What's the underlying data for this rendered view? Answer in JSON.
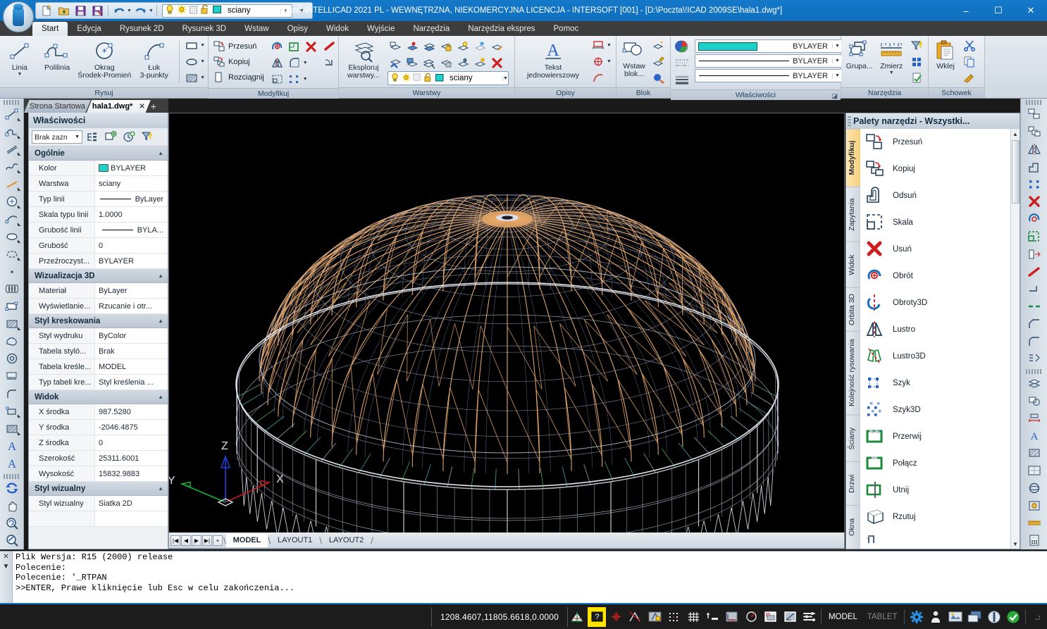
{
  "window": {
    "title": "INTERsoft-INTELLICAD 2021 PL - WEWNĘTRZNA, NIEKOMERCYJNA LICENCJA - INTERSOFT [001] - [D:\\Poczta\\!ICAD 2009SE\\hala1.dwg*]",
    "minimize": "–",
    "maximize": "☐",
    "close": "✕",
    "accent": "#1478c8"
  },
  "quick_access": {
    "layer_value": "sciany",
    "buttons": [
      {
        "name": "new-file-icon",
        "tip": "Nowy"
      },
      {
        "name": "open-file-icon",
        "tip": "Otwórz"
      },
      {
        "name": "save-icon",
        "tip": "Zapisz"
      },
      {
        "name": "save-as-icon",
        "tip": "Zapisz jako"
      },
      {
        "name": "undo-icon",
        "tip": "Cofnij"
      },
      {
        "name": "redo-icon",
        "tip": "Ponów"
      }
    ]
  },
  "ribbon": {
    "tabs": [
      {
        "label": "Start",
        "active": true
      },
      {
        "label": "Edycja",
        "active": false
      },
      {
        "label": "Rysunek 2D",
        "active": false
      },
      {
        "label": "Rysunek 3D",
        "active": false
      },
      {
        "label": "Wstaw",
        "active": false
      },
      {
        "label": "Opisy",
        "active": false
      },
      {
        "label": "Widok",
        "active": false
      },
      {
        "label": "Wyjście",
        "active": false
      },
      {
        "label": "Narzędzia",
        "active": false
      },
      {
        "label": "Narzędzia ekspres",
        "active": false
      },
      {
        "label": "Pomoc",
        "active": false
      }
    ],
    "panels": {
      "rysuj": {
        "title": "Rysuj",
        "linia": "Linia",
        "polilinia": "Polilinia",
        "okrag": "Okrag",
        "okrag_sub": "Środek-Promień",
        "luk": "Łuk",
        "luk_sub": "3-punkty"
      },
      "modyfikuj": {
        "title": "Modyfikuj",
        "przesun": "Przesuń",
        "kopiuj": "Kopiuj",
        "rozciagnij": "Rozciągnij"
      },
      "warstwy": {
        "title": "Warstwy",
        "eksploruj": "Eksploruj",
        "eksploruj2": "warstwy...",
        "current_layer": "sciany"
      },
      "opisy": {
        "title": "Opisy",
        "tekst": "Tekst",
        "tekst_sub": "jednowierszowy"
      },
      "blok": {
        "title": "Blok",
        "wstaw": "Wstaw",
        "wstaw_sub": "blok..."
      },
      "wlasciwosci": {
        "title": "Właściwości",
        "color_value": "BYLAYER",
        "linetype_value": "BYLAYER",
        "lineweight_value": "BYLAYER",
        "color_swatch": "#1ed0c8"
      },
      "narzedzia": {
        "title": "Narzędzia",
        "grupa": "Grupa...",
        "zmierz": "Zmierz"
      },
      "schowek": {
        "title": "Schowek",
        "wklej": "Wklej"
      }
    }
  },
  "doc_tabs": [
    {
      "label": "Strona Startowa",
      "active": false,
      "closable": false
    },
    {
      "label": "hala1.dwg*",
      "active": true,
      "closable": true
    }
  ],
  "doc_tab_add": "+",
  "properties": {
    "title": "Właściwości",
    "selection": "Brak zazn",
    "toolbar_icons": [
      "quick-select-icon",
      "select-objects-icon",
      "pickadd-icon",
      "filter-icon"
    ],
    "groups": [
      {
        "name": "Ogólnie",
        "rows": [
          {
            "key": "Kolor",
            "value": "BYLAYER",
            "swatch": "#1ed0c8"
          },
          {
            "key": "Warstwa",
            "value": "sciany"
          },
          {
            "key": "Typ linii",
            "value": "ByLayer",
            "line": true
          },
          {
            "key": "Skala typu linii",
            "value": "1.0000"
          },
          {
            "key": "Grubość linii",
            "value": "BYLA...",
            "line": true
          },
          {
            "key": "Grubość",
            "value": "0"
          },
          {
            "key": "Przeźroczyst...",
            "value": "BYLAYER"
          }
        ]
      },
      {
        "name": "Wizualizacja 3D",
        "rows": [
          {
            "key": "Materiał",
            "value": "ByLayer"
          },
          {
            "key": "Wyświetlanie...",
            "value": "Rzucanie i otr..."
          }
        ]
      },
      {
        "name": "Styl kreskowania",
        "rows": [
          {
            "key": "Styl wydruku",
            "value": "ByColor"
          },
          {
            "key": "Tabela styló...",
            "value": "Brak"
          },
          {
            "key": "Tabela kreśle...",
            "value": "MODEL"
          },
          {
            "key": "Typ tabeli kre...",
            "value": "Styl kreślenia ..."
          }
        ]
      },
      {
        "name": "Widok",
        "rows": [
          {
            "key": "X środka",
            "value": "987.5280"
          },
          {
            "key": "Y środka",
            "value": "-2046.4875"
          },
          {
            "key": "Z środka",
            "value": "0"
          },
          {
            "key": "Szerokość",
            "value": "25311.6001"
          },
          {
            "key": "Wysokość",
            "value": "15832.9883"
          }
        ]
      },
      {
        "name": "Styl wizualny",
        "rows": [
          {
            "key": "Styl wizualny",
            "value": "Siatka 2D"
          }
        ]
      }
    ]
  },
  "canvas": {
    "ucs": {
      "x": "X",
      "y": "Y",
      "z": "Z"
    },
    "background": "#000000",
    "model_colors": {
      "dome_ribs": "#f0b277",
      "grid": "#b9c6e8",
      "outer_frame": "#d8dde8",
      "accent_cyan": "#55d8e0",
      "accent_green": "#6fe07a"
    }
  },
  "layout_tabs": {
    "nav": [
      "|◀",
      "◀",
      "▶",
      "▶|",
      "+"
    ],
    "tabs": [
      {
        "label": "MODEL",
        "active": true
      },
      {
        "label": "LAYOUT1",
        "active": false
      },
      {
        "label": "LAYOUT2",
        "active": false
      }
    ]
  },
  "tool_palette": {
    "title": "Palety narzędzi - Wszystki...",
    "side_tabs": [
      {
        "label": "Modyfikuj",
        "active": true
      },
      {
        "label": "Zapytania",
        "active": false
      },
      {
        "label": "Widok",
        "active": false
      },
      {
        "label": "Orbita 3D",
        "active": false
      },
      {
        "label": "Kolejność rysowania",
        "active": false
      },
      {
        "label": "Ściany",
        "active": false
      },
      {
        "label": "Drzwi",
        "active": false
      },
      {
        "label": "Okna",
        "active": false
      }
    ],
    "items": [
      {
        "label": "Przesuń",
        "icon": "move-icon"
      },
      {
        "label": "Kopiuj",
        "icon": "copy-icon"
      },
      {
        "label": "Odsuń",
        "icon": "offset-icon"
      },
      {
        "label": "Skala",
        "icon": "scale-icon"
      },
      {
        "label": "Usuń",
        "icon": "delete-icon"
      },
      {
        "label": "Obrót",
        "icon": "rotate-icon"
      },
      {
        "label": "Obroty3D",
        "icon": "rotate3d-icon"
      },
      {
        "label": "Lustro",
        "icon": "mirror-icon"
      },
      {
        "label": "Lustro3D",
        "icon": "mirror3d-icon"
      },
      {
        "label": "Szyk",
        "icon": "array-icon"
      },
      {
        "label": "Szyk3D",
        "icon": "array3d-icon"
      },
      {
        "label": "Przerwij",
        "icon": "break-icon"
      },
      {
        "label": "Połącz",
        "icon": "join-icon"
      },
      {
        "label": "Utnij",
        "icon": "trim-icon"
      },
      {
        "label": "Rzutuj",
        "icon": "project-icon"
      }
    ]
  },
  "command_line": {
    "lines": [
      "Plik Wersja: R15 (2000) release",
      "Polecenie:",
      "Polecenie: '_RTPAN",
      ">>ENTER, Prawe kliknięcie lub Esc w celu zakończenia..."
    ]
  },
  "status_bar": {
    "coordinates": "1208.4607,11805.6618,0.0000",
    "model_label": "MODEL",
    "tablet_label": "TABLET",
    "toggles": [
      {
        "name": "ortho-icon",
        "on": false
      },
      {
        "name": "esnap-help-icon",
        "on": true
      },
      {
        "name": "osnap-icon",
        "on": false
      },
      {
        "name": "polar-icon",
        "on": false
      },
      {
        "name": "otrack-icon",
        "on": false
      },
      {
        "name": "snap-icon",
        "on": false
      },
      {
        "name": "grid-icon",
        "on": false
      },
      {
        "name": "lineweight-icon",
        "on": false
      },
      {
        "name": "ucs-icon",
        "on": false
      },
      {
        "name": "angle-icon",
        "on": false
      },
      {
        "name": "viewport-icon",
        "on": false
      },
      {
        "name": "isometric-icon",
        "on": false
      },
      {
        "name": "settings-list-icon",
        "on": false
      }
    ],
    "right_icons": [
      {
        "name": "gear-icon"
      },
      {
        "name": "person-icon"
      },
      {
        "name": "display-icon"
      },
      {
        "name": "windows-icon"
      },
      {
        "name": "clean-screen-icon"
      },
      {
        "name": "check-icon"
      }
    ]
  }
}
